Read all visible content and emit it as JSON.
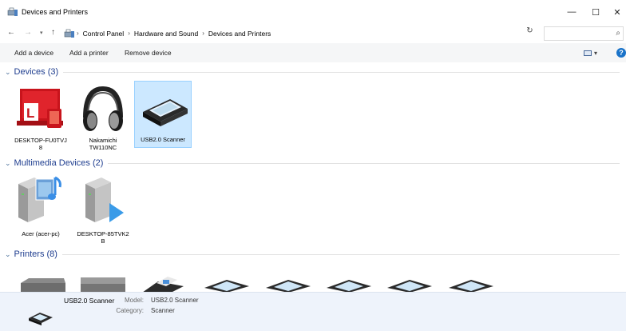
{
  "window": {
    "title": "Devices and Printers",
    "minimize": "—",
    "maximize": "☐",
    "close": "✕"
  },
  "address": {
    "crumbs": [
      "Control Panel",
      "Hardware and Sound",
      "Devices and Printers"
    ],
    "search_placeholder": ""
  },
  "commands": {
    "add_device": "Add a device",
    "add_printer": "Add a printer",
    "remove_device": "Remove device"
  },
  "groups": {
    "devices": {
      "title": "Devices (3)",
      "items": [
        {
          "label": "DESKTOP-FU0TVJ8",
          "line1": "DESKTOP-FU0TVJ",
          "line2": "8"
        },
        {
          "label": "Nakamichi TW110NC",
          "line1": "Nakamichi",
          "line2": "TW110NC"
        },
        {
          "label": "USB2.0 Scanner",
          "line1": "USB2.0 Scanner",
          "line2": ""
        }
      ]
    },
    "multimedia": {
      "title": "Multimedia Devices (2)",
      "items": [
        {
          "label": "Acer (acer-pc)",
          "line1": "Acer (acer-pc)",
          "line2": ""
        },
        {
          "label": "DESKTOP-85TVK2B",
          "line1": "DESKTOP-85TVK2",
          "line2": "B"
        }
      ]
    },
    "printers": {
      "title": "Printers (8)"
    }
  },
  "details": {
    "name": "USB2.0 Scanner",
    "model_label": "Model:",
    "model_value": "USB2.0 Scanner",
    "category_label": "Category:",
    "category_value": "Scanner"
  },
  "colors": {
    "accent": "#1e3d8f",
    "selection": "#cce8ff",
    "details_bg": "#eef3fb"
  }
}
